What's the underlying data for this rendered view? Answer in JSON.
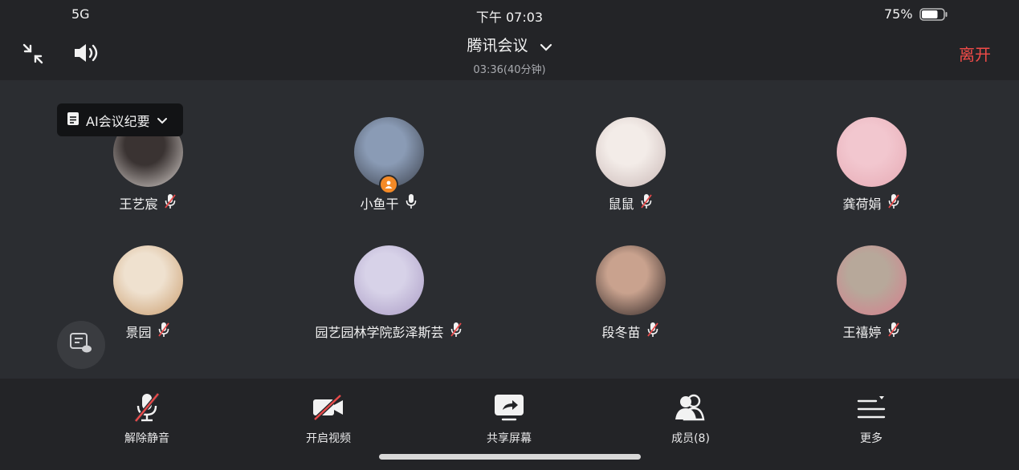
{
  "status_bar": {
    "network": "5G",
    "time": "下午 07:03",
    "battery": "75%",
    "battery_level": 0.75
  },
  "header": {
    "title": "腾讯会议",
    "duration": "03:36(40分钟)",
    "leave_label": "离开",
    "icons": {
      "collapse": "collapse-arrows-icon",
      "speaker": "speaker-icon",
      "title_dropdown": "chevron-down-icon"
    }
  },
  "ai_summary": {
    "label": "AI会议纪要",
    "icon": "document-icon",
    "dropdown_icon": "chevron-down-icon"
  },
  "participants": [
    {
      "name": "王艺宸",
      "mic": "muted",
      "avatar_colors": [
        "#3a3332",
        "#d9d2ce"
      ]
    },
    {
      "name": "小鱼干",
      "mic": "on",
      "host": true,
      "avatar_colors": [
        "#8a9bb5",
        "#3a3f4a"
      ]
    },
    {
      "name": "鼠鼠",
      "mic": "muted",
      "avatar_colors": [
        "#f3ece8",
        "#c9b7b5"
      ]
    },
    {
      "name": "龚荷娟",
      "mic": "muted",
      "avatar_colors": [
        "#f2c7cf",
        "#e6a9b3"
      ]
    },
    {
      "name": "景园",
      "mic": "muted",
      "avatar_colors": [
        "#efe1cf",
        "#c99b6b"
      ]
    },
    {
      "name": "园艺园林学院彭泽斯芸",
      "mic": "muted",
      "avatar_colors": [
        "#d7d2e8",
        "#a99ac4"
      ]
    },
    {
      "name": "段冬苗",
      "mic": "muted",
      "avatar_colors": [
        "#c9a28e",
        "#2a2222"
      ]
    },
    {
      "name": "王禧婷",
      "mic": "muted",
      "avatar_colors": [
        "#b7a89a",
        "#d77c8c"
      ]
    }
  ],
  "toolbar": [
    {
      "label": "解除静音",
      "icon": "mic-muted-icon"
    },
    {
      "label": "开启视频",
      "icon": "video-off-icon"
    },
    {
      "label": "共享屏幕",
      "icon": "share-screen-icon"
    },
    {
      "label": "成员(8)",
      "icon": "members-icon"
    },
    {
      "label": "更多",
      "icon": "more-menu-icon"
    }
  ],
  "chat_button": {
    "icon": "chat-bubble-icon"
  },
  "colors": {
    "background": "#2b2d31",
    "header": "#232427",
    "leave_red": "#f14b48",
    "host_badge": "#f58a26",
    "muted_red": "#e84a4a"
  }
}
